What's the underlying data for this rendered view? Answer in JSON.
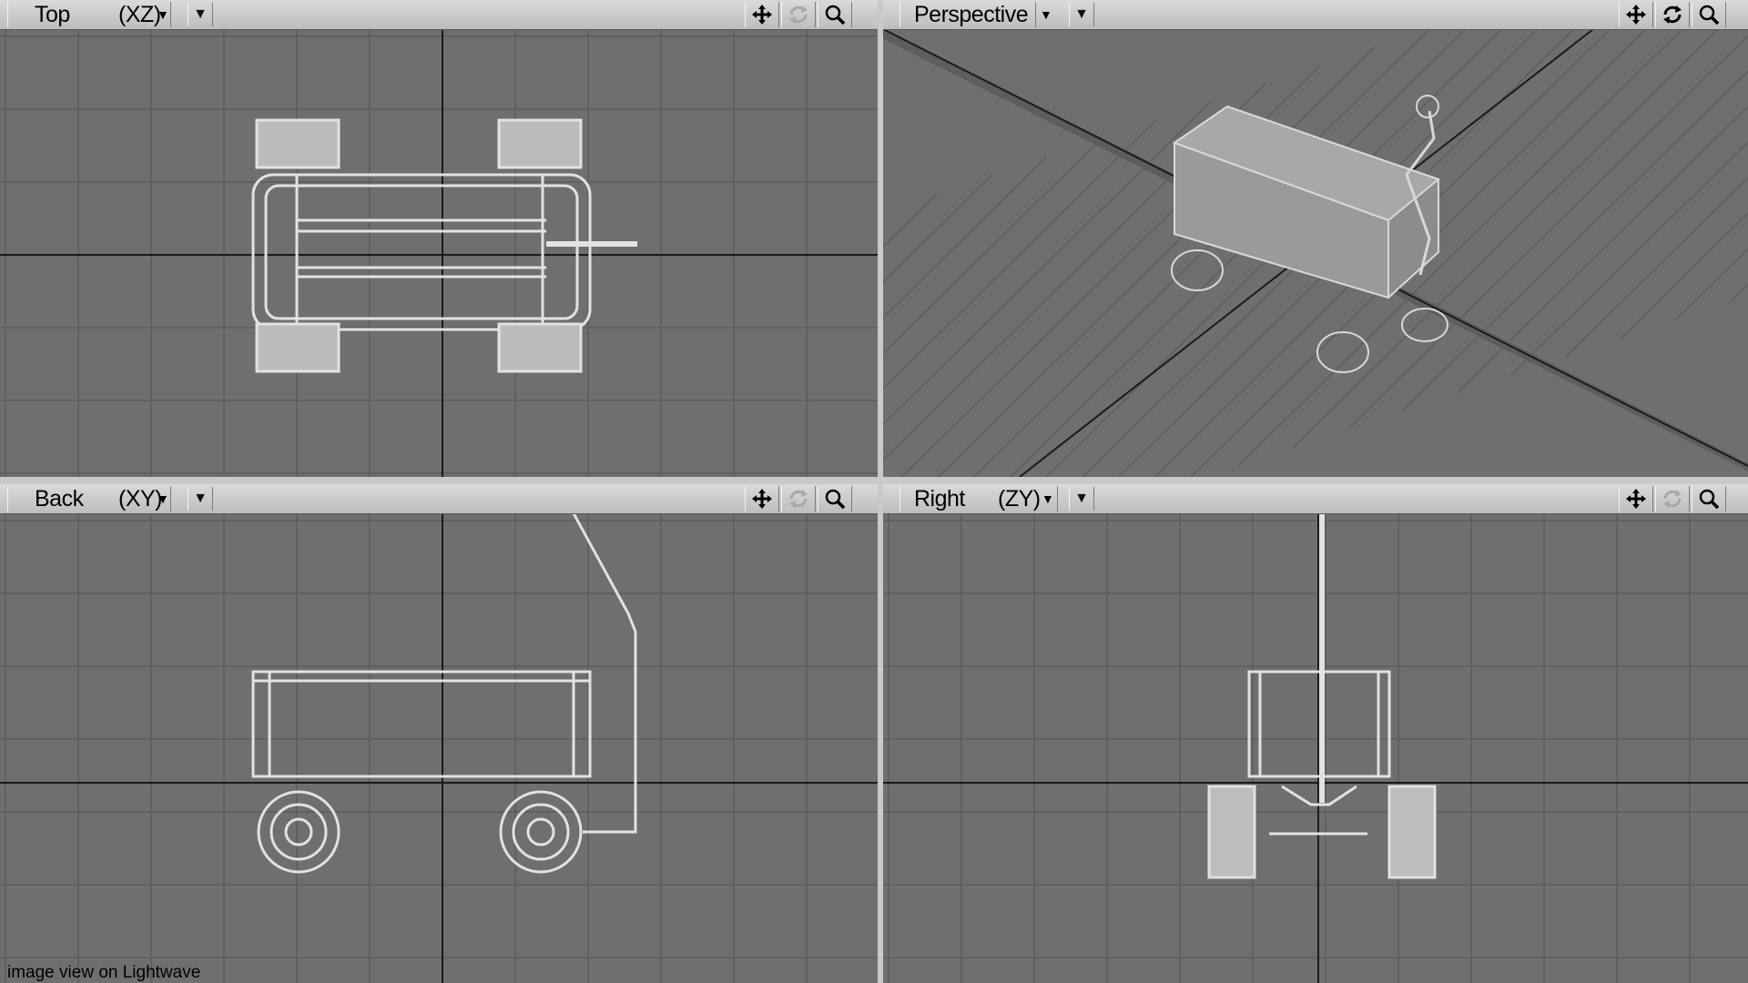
{
  "viewports": {
    "top": {
      "name": "Top",
      "axes": "(XZ)"
    },
    "perspective": {
      "name": "Perspective",
      "axes": ""
    },
    "back": {
      "name": "Back",
      "axes": "(XY)"
    },
    "right": {
      "name": "Right",
      "axes": "(ZY)"
    }
  },
  "toolbar_icons": [
    "move-icon",
    "rotate-icon",
    "zoom-icon"
  ],
  "colors": {
    "viewport_bg": "#6f6f6f",
    "grid_line": "#5c5c5c",
    "axis_line": "#1a1a1a",
    "wireframe": "#e0e0e0",
    "header_bg": "#c8c8c8"
  },
  "caption": "image view on Lightwave"
}
